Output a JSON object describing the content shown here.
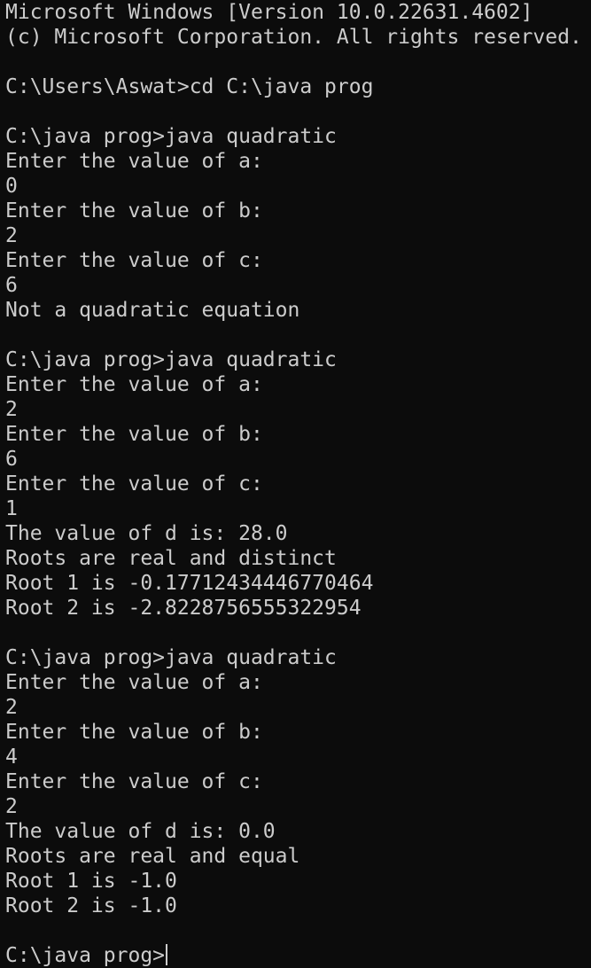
{
  "terminal": {
    "lines": [
      "Microsoft Windows [Version 10.0.22631.4602]",
      "(c) Microsoft Corporation. All rights reserved.",
      "",
      "C:\\Users\\Aswat>cd C:\\java prog",
      "",
      "C:\\java prog>java quadratic",
      "Enter the value of a:",
      "0",
      "Enter the value of b:",
      "2",
      "Enter the value of c:",
      "6",
      "Not a quadratic equation",
      "",
      "C:\\java prog>java quadratic",
      "Enter the value of a:",
      "2",
      "Enter the value of b:",
      "6",
      "Enter the value of c:",
      "1",
      "The value of d is: 28.0",
      "Roots are real and distinct",
      "Root 1 is -0.17712434446770464",
      "Root 2 is -2.8228756555322954",
      "",
      "C:\\java prog>java quadratic",
      "Enter the value of a:",
      "2",
      "Enter the value of b:",
      "4",
      "Enter the value of c:",
      "2",
      "The value of d is: 0.0",
      "Roots are real and equal",
      "Root 1 is -1.0",
      "Root 2 is -1.0",
      ""
    ],
    "prompt": "C:\\java prog>"
  }
}
